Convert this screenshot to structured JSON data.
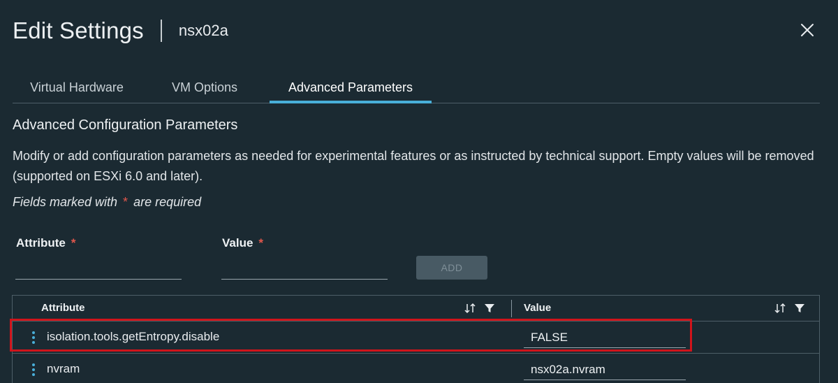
{
  "dialog": {
    "title": "Edit Settings",
    "vm_name": "nsx02a"
  },
  "tabs": [
    {
      "label": "Virtual Hardware",
      "active": false
    },
    {
      "label": "VM Options",
      "active": false
    },
    {
      "label": "Advanced Parameters",
      "active": true
    }
  ],
  "section": {
    "title": "Advanced Configuration Parameters",
    "description": "Modify or add configuration parameters as needed for experimental features or as instructed by technical support. Empty values will be removed (supported on ESXi 6.0 and later).",
    "required_prefix": "Fields marked with",
    "required_star": "*",
    "required_suffix": "are required"
  },
  "form": {
    "attribute_label": "Attribute",
    "value_label": "Value",
    "required_mark": "*",
    "attribute_value": "",
    "value_value": "",
    "add_label": "ADD"
  },
  "grid": {
    "columns": [
      "Attribute",
      "Value"
    ],
    "rows": [
      {
        "attribute": "isolation.tools.getEntropy.disable",
        "value": "FALSE",
        "highlighted": true
      },
      {
        "attribute": "nvram",
        "value": "nsx02a.nvram",
        "highlighted": false
      }
    ]
  },
  "colors": {
    "background": "#1b2a32",
    "accent": "#49afd9",
    "required": "#e2574c",
    "highlight": "#d0141b"
  },
  "icons": [
    "close-icon",
    "sort-icon",
    "filter-icon",
    "kebab-menu-icon"
  ]
}
